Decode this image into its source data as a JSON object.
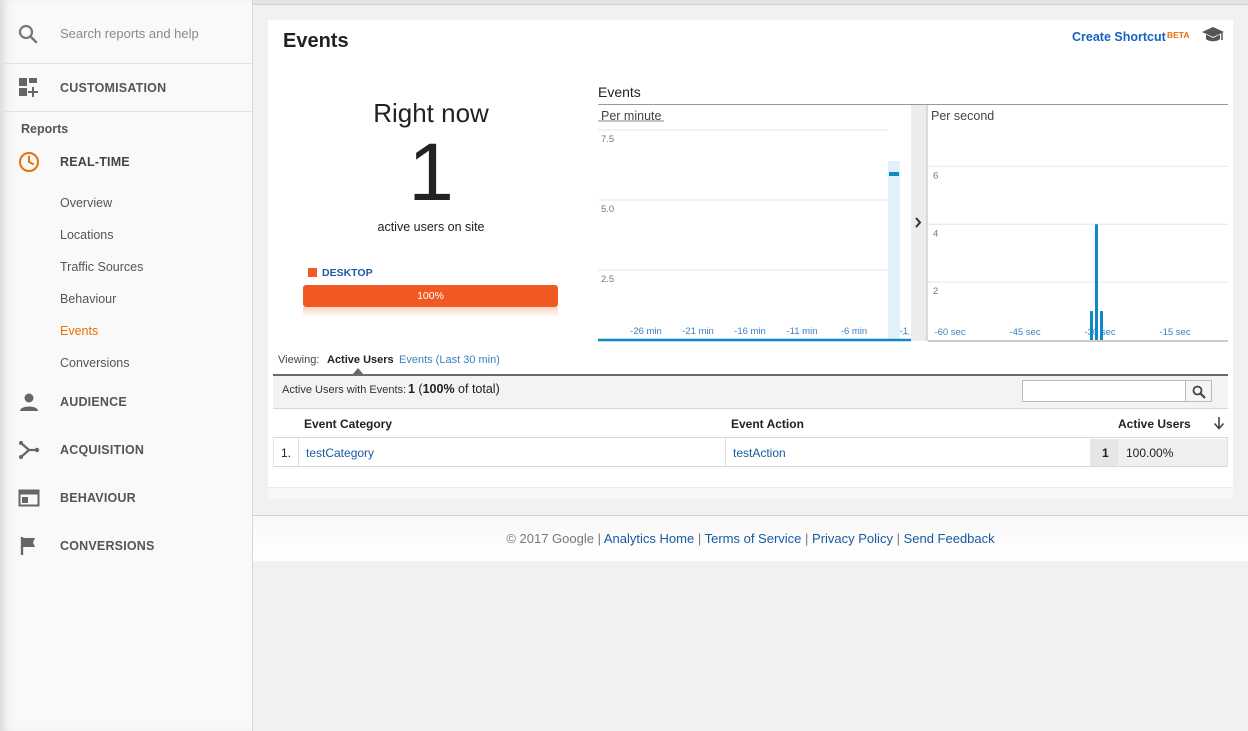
{
  "sidebar": {
    "search_placeholder": "Search reports and help",
    "customisation": "CUSTOMISATION",
    "reports_label": "Reports",
    "realtime": "REAL-TIME",
    "realtime_items": [
      "Overview",
      "Locations",
      "Traffic Sources",
      "Behaviour",
      "Events",
      "Conversions"
    ],
    "active_item": "Events",
    "audience": "AUDIENCE",
    "acquisition": "ACQUISITION",
    "behaviour": "BEHAVIOUR",
    "conversions": "CONVERSIONS"
  },
  "header": {
    "title": "Events",
    "create_shortcut": "Create Shortcut",
    "beta": "BETA"
  },
  "right_now": {
    "title": "Right now",
    "count": "1",
    "subtitle": "active users on site",
    "device_label": "DESKTOP",
    "device_percent": "100%",
    "device_fraction": 1.0
  },
  "chart_data": [
    {
      "type": "bar",
      "title": "Events",
      "subtitle": "Per minute",
      "y_ticks": [
        "7.5",
        "5.0",
        "2.5"
      ],
      "x_ticks": [
        "-26 min",
        "-21 min",
        "-16 min",
        "-11 min",
        "-6 min",
        "-1"
      ],
      "x_tail_label": "...",
      "ylim": [
        0,
        7.5
      ],
      "bar_x_minutes": -1,
      "bar_value": 6
    },
    {
      "type": "bar",
      "subtitle": "Per second",
      "y_ticks": [
        "6",
        "4",
        "2"
      ],
      "x_ticks": [
        "-60 sec",
        "-45 sec",
        "-30 sec",
        "-15 sec"
      ],
      "ylim": [
        0,
        7.5
      ],
      "bars": [
        {
          "x_sec": -31,
          "value": 1
        },
        {
          "x_sec": -30,
          "value": 4
        },
        {
          "x_sec": -29,
          "value": 1
        }
      ]
    }
  ],
  "viewing": {
    "label": "Viewing:",
    "active": "Active Users",
    "alt": "Events (Last 30 min)"
  },
  "table": {
    "summary_label": "Active Users with Events:",
    "summary_value": "1",
    "summary_pct": "100%",
    "summary_suffix": " of total)",
    "columns": [
      "Event Category",
      "Event Action",
      "Active Users"
    ],
    "rows": [
      {
        "num": "1.",
        "category": "testCategory",
        "action": "testAction",
        "users": "1",
        "pct": "100.00%"
      }
    ]
  },
  "footer": {
    "copyright": "© 2017 Google",
    "links": [
      "Analytics Home",
      "Terms of Service",
      "Privacy Policy",
      "Send Feedback"
    ]
  },
  "colors": {
    "accent": "#e8710a",
    "device": "#f05a22",
    "bar": "#0f88c7",
    "link": "#1a5aa0"
  }
}
